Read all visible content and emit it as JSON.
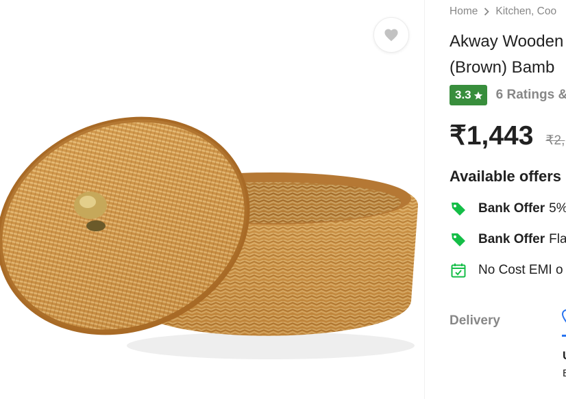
{
  "colors": {
    "rating_badge": "#388e3c",
    "offer_icon": "#14be47",
    "muted_text": "#878787",
    "accent_blue": "#2874f0"
  },
  "image": {
    "alt": "Round woven rattan basket with lid and brass knob",
    "wishlist_icon": "heart-icon"
  },
  "breadcrumb": {
    "items": [
      "Home",
      "Kitchen, Coo"
    ],
    "separator_icon": "chevron-right-icon"
  },
  "product": {
    "title_line1": "Akway Wooden",
    "title_line2": "(Brown) Bamb",
    "rating": "3.3",
    "rating_icon": "star-icon",
    "ratings_text": "6 Ratings &",
    "price": "₹1,443",
    "mrp": "₹2,"
  },
  "offers": {
    "heading": "Available offers",
    "items": [
      {
        "icon": "tag-icon",
        "title": "Bank Offer",
        "text": "5%"
      },
      {
        "icon": "tag-icon",
        "title": "Bank Offer",
        "text": "Fla"
      },
      {
        "icon": "calendar-icon",
        "title": "",
        "text": "No Cost EMI o"
      }
    ]
  },
  "delivery": {
    "label": "Delivery",
    "location_icon": "location-pin-icon",
    "fragment_1": "U",
    "fragment_2": "E"
  }
}
